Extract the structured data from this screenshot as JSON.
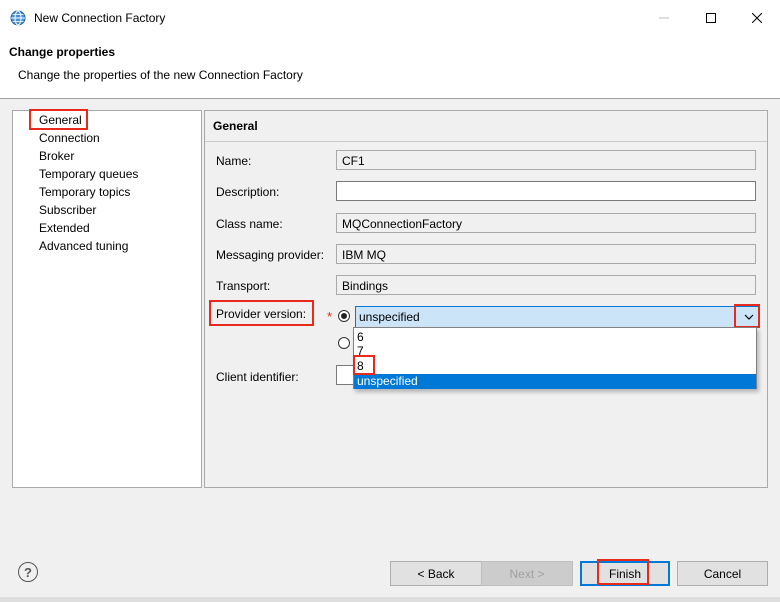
{
  "window": {
    "title": "New Connection Factory",
    "controls": {
      "minimize": "—",
      "maximize": "☐",
      "close": "✕"
    }
  },
  "banner": {
    "heading": "Change properties",
    "subtitle": "Change the properties of the new Connection Factory"
  },
  "nav": {
    "items": [
      {
        "label": "General"
      },
      {
        "label": "Connection"
      },
      {
        "label": "Broker"
      },
      {
        "label": "Temporary queues"
      },
      {
        "label": "Temporary topics"
      },
      {
        "label": "Subscriber"
      },
      {
        "label": "Extended"
      },
      {
        "label": "Advanced tuning"
      }
    ],
    "selected": "General"
  },
  "general": {
    "heading": "General",
    "name": {
      "label": "Name:",
      "value": "CF1"
    },
    "description": {
      "label": "Description:",
      "value": ""
    },
    "class_name": {
      "label": "Class name:",
      "value": "MQConnectionFactory"
    },
    "messaging_provider": {
      "label": "Messaging provider:",
      "value": "IBM MQ"
    },
    "transport": {
      "label": "Transport:",
      "value": "Bindings"
    },
    "provider_version": {
      "label": "Provider version:",
      "required_marker": "*",
      "selected": "unspecified",
      "options": [
        "6",
        "7",
        "8",
        "unspecified"
      ]
    },
    "client_identifier": {
      "label": "Client identifier:",
      "value": ""
    }
  },
  "buttons": {
    "help": "?",
    "back": "< Back",
    "next": "Next >",
    "finish": "Finish",
    "cancel": "Cancel"
  },
  "colors": {
    "highlight_box": "#e8291c",
    "selection_blue": "#0078d7",
    "combo_bg": "#cce4f7"
  }
}
